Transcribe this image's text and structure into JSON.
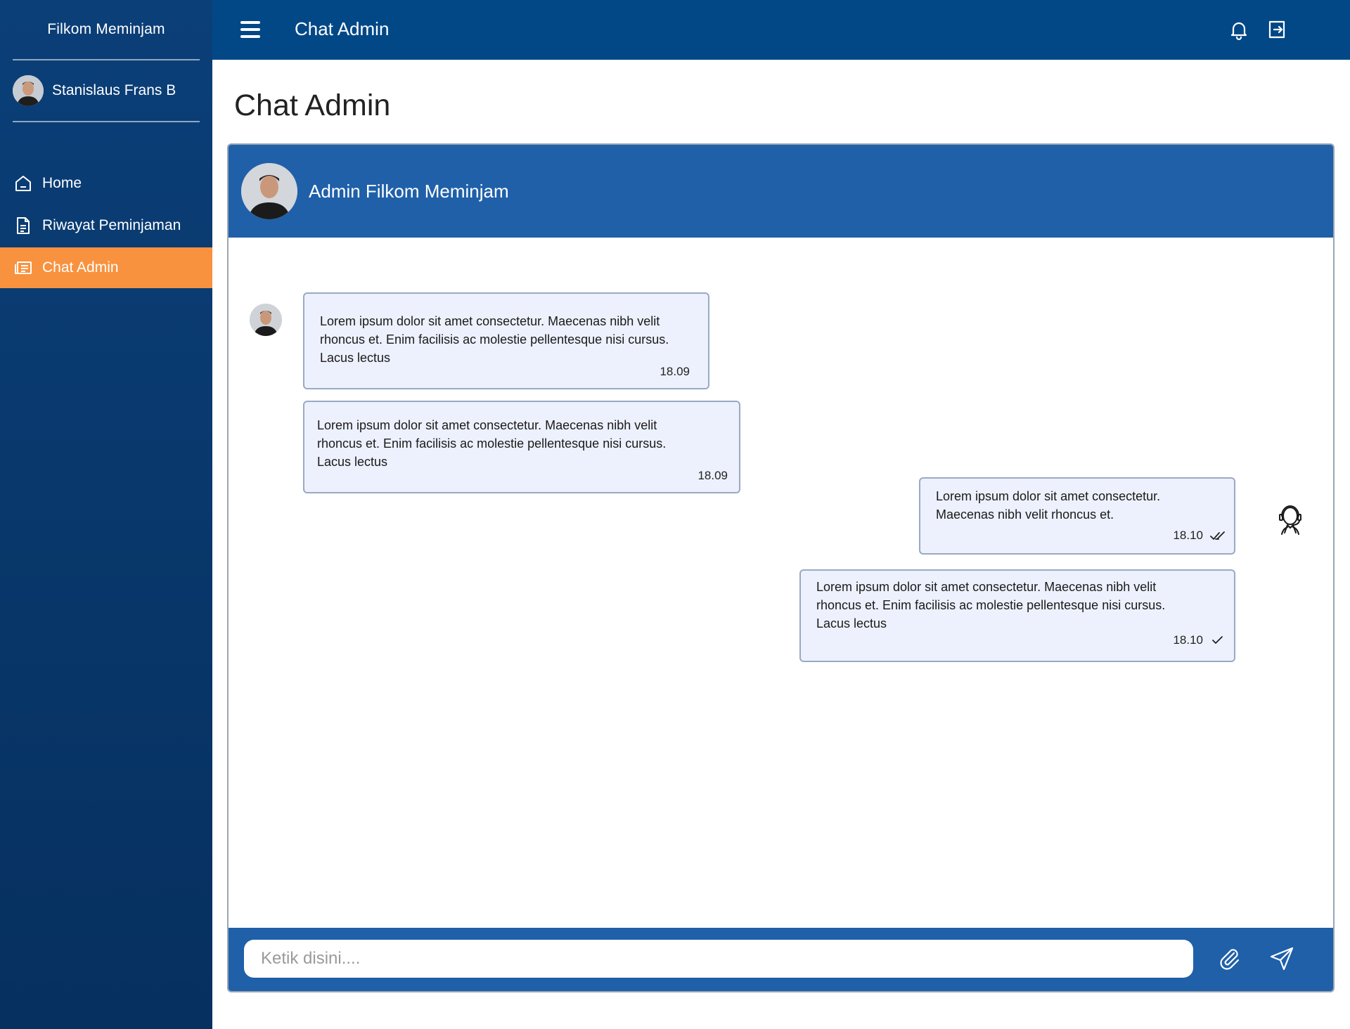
{
  "sidebar": {
    "brand": "Filkom Meminjam",
    "user_name": "Stanislaus Frans B",
    "items": [
      {
        "label": "Home",
        "icon": "home-icon",
        "active": false
      },
      {
        "label": "Riwayat Peminjaman",
        "icon": "document-icon",
        "active": false
      },
      {
        "label": "Chat Admin",
        "icon": "chat-list-icon",
        "active": true
      }
    ]
  },
  "topbar": {
    "title": "Chat Admin",
    "icons": [
      "menu-icon",
      "bell-icon",
      "logout-icon"
    ]
  },
  "page": {
    "title": "Chat Admin"
  },
  "chat": {
    "contact_name": "Admin Filkom Meminjam",
    "messages": [
      {
        "sender": "other",
        "text": "Lorem ipsum dolor sit amet consectetur. Maecenas nibh velit rhoncus et. Enim facilisis ac molestie pellentesque nisi cursus. Lacus lectus",
        "time": "18.09",
        "status": ""
      },
      {
        "sender": "other",
        "text": "Lorem ipsum dolor sit amet consectetur. Maecenas nibh velit rhoncus et. Enim facilisis ac molestie pellentesque nisi cursus. Lacus lectus",
        "time": "18.09",
        "status": ""
      },
      {
        "sender": "me",
        "text": "Lorem ipsum dolor sit amet consectetur. Maecenas nibh velit rhoncus et.",
        "time": "18.10",
        "status": "read"
      },
      {
        "sender": "me",
        "text": "Lorem ipsum dolor sit amet consectetur. Maecenas nibh velit rhoncus et. Enim facilisis ac molestie pellentesque nisi cursus. Lacus lectus",
        "time": "18.10",
        "status": "sent"
      }
    ],
    "composer": {
      "placeholder": "Ketik disini...."
    }
  },
  "colors": {
    "sidebar": "#0b3f78",
    "topbar": "#024887",
    "chat_header": "#1f60a9",
    "active_nav": "#f8923f",
    "bubble_bg": "#edf1fd",
    "bubble_border": "#9aa9c4"
  }
}
